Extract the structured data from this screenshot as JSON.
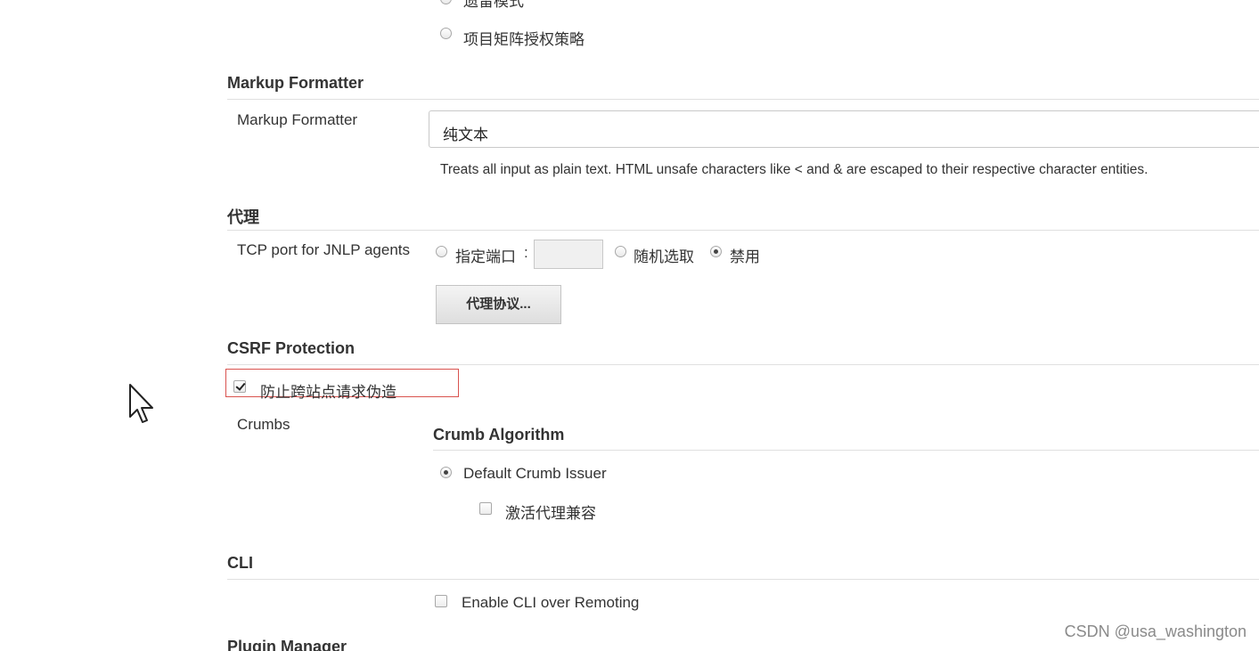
{
  "authorization": {
    "top_option_label": "遗留模式",
    "project_matrix_label": "项目矩阵授权策略"
  },
  "markup_formatter": {
    "section_title": "Markup Formatter",
    "field_label": "Markup Formatter",
    "selected_value": "纯文本",
    "help_text": "Treats all input as plain text. HTML unsafe characters like < and & are escaped to their respective character entities."
  },
  "agents": {
    "section_title": "代理",
    "field_label": "TCP port for JNLP agents",
    "options": {
      "fixed_label": "指定端口",
      "port_separator": ":",
      "random_label": "随机选取",
      "disable_label": "禁用"
    },
    "port_value": "",
    "selected_option": "禁用",
    "protocols_button": "代理协议..."
  },
  "csrf": {
    "section_title": "CSRF Protection",
    "prevent_label": "防止跨站点请求伪造",
    "prevent_checked": true,
    "crumbs_label": "Crumbs",
    "crumb_algorithm_title": "Crumb Algorithm",
    "default_issuer_label": "Default Crumb Issuer",
    "default_issuer_selected": true,
    "proxy_compat_label": "激活代理兼容",
    "proxy_compat_checked": false
  },
  "cli": {
    "section_title": "CLI",
    "remoting_label": "Enable CLI over Remoting",
    "remoting_checked": false
  },
  "plugin_manager": {
    "section_title": "Plugin Manager"
  },
  "watermark": "CSDN @usa_washington",
  "colors": {
    "highlight_border": "#d9534f",
    "section_rule": "#e0e0e0",
    "text": "#333333"
  },
  "icons": {
    "cursor": "mouse-pointer-icon"
  }
}
